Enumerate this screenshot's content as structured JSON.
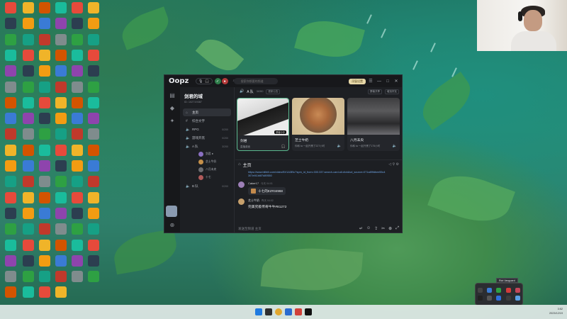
{
  "app": {
    "logo": "Oopz",
    "title_pill_icons": [
      "mic-icon",
      "headphones-icon"
    ],
    "search_placeholder": "搜索你想要的频道",
    "cta_label": "浮窗设置",
    "window_controls": [
      "—",
      "□",
      "✕"
    ]
  },
  "panel": {
    "guild_name": "剑君的域",
    "guild_id": "ID: 102719387",
    "channels": [
      {
        "icon": "home-icon",
        "label": "主页",
        "active": true,
        "count": ""
      },
      {
        "icon": "hash-icon",
        "label": "综合文字",
        "active": false,
        "count": ""
      },
      {
        "icon": "speaker-icon",
        "label": "RPG",
        "active": false,
        "count": "0/200"
      },
      {
        "icon": "speaker-icon",
        "label": "游戏开黑",
        "active": false,
        "count": "0/200"
      },
      {
        "icon": "speaker-icon",
        "label": "A 队",
        "active": false,
        "count": "3/200"
      }
    ],
    "members": [
      {
        "name": "剑君 ●"
      },
      {
        "name": "芝士牛奶"
      },
      {
        "name": "八月未央"
      },
      {
        "name": "十七"
      }
    ],
    "last_channel": {
      "icon": "speaker-icon",
      "label": "B 队",
      "count": "0/200"
    }
  },
  "voice": {
    "channel_name": "A 队",
    "channel_id": "34050",
    "tag": "更新公告",
    "actions": [
      "屏幕共享",
      "增加好友"
    ],
    "tiles": [
      {
        "name": "剑君",
        "status": "直播桌面",
        "highlight": true,
        "badge": "屏幕分享"
      },
      {
        "name": "芝士牛奶",
        "status": "你和 ta 一起开黑了227小时",
        "highlight": false,
        "badge": ""
      },
      {
        "name": "八月未央",
        "status": "你和 ta 一起开黑了175小时",
        "highlight": false,
        "badge": ""
      }
    ]
  },
  "chat": {
    "channel": "主页",
    "link": "https://www.bilibili.com/video/BV1A3Ek/?spm_id_from=333.337.search-card.all.click&vd_source=071a89fdbee55c4307ef41b6f7d89550",
    "messages": [
      {
        "author": "Caker17",
        "time": "今天 04:01",
        "bubble": "十七的EZ#34968",
        "text": ""
      },
      {
        "author": "芝士牛奶",
        "time": "昨天 04:02",
        "bubble": "",
        "text": "完美究极传奇牛牛#81272"
      }
    ],
    "composer_placeholder": "发送至频道 主页"
  },
  "taskbar": {
    "time": "3:52",
    "date": "2023/12/19"
  },
  "tray": {
    "tooltip": "Riot Vanguard"
  },
  "desktop_icons": [
    "Chrome",
    "PUBG",
    "Steam",
    "Discord",
    "WeChat",
    "QQ",
    "EPIC",
    "TikTok",
    "Wallpaper",
    "Oopz"
  ]
}
